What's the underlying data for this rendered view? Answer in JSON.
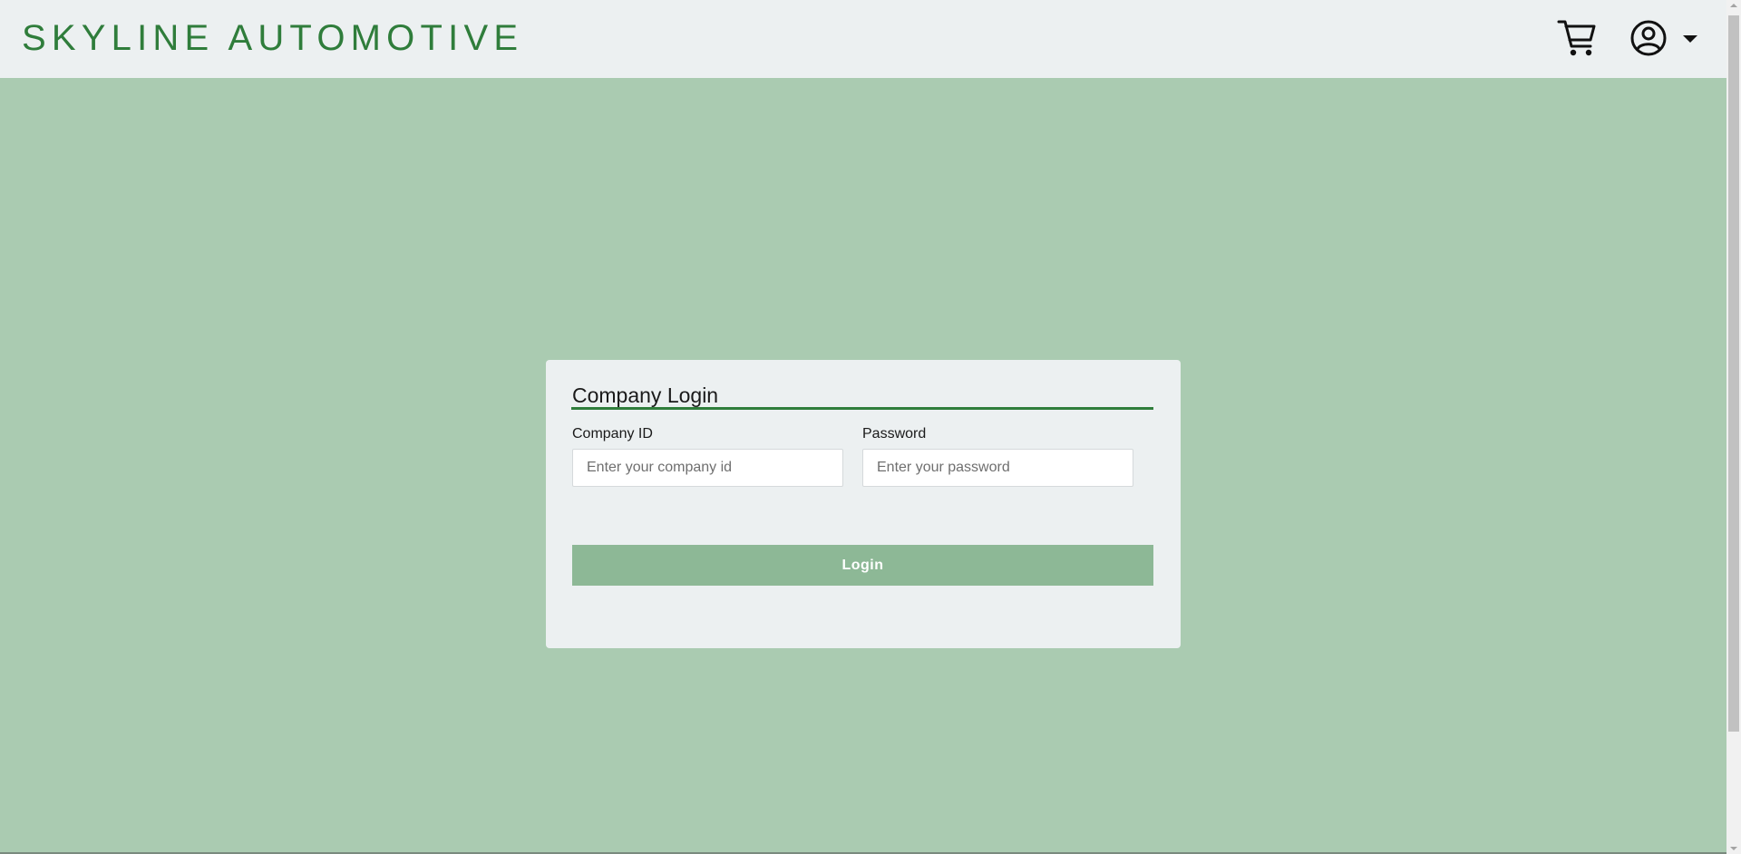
{
  "header": {
    "brand": "SKYLINE AUTOMOTIVE",
    "cart_icon": "cart-icon",
    "account_icon": "user-circle-icon",
    "account_menu_icon": "caret-down-icon"
  },
  "login_card": {
    "title": "Company Login",
    "company_id": {
      "label": "Company ID",
      "placeholder": "Enter your company id",
      "value": ""
    },
    "password": {
      "label": "Password",
      "placeholder": "Enter your password",
      "value": ""
    },
    "submit_label": "Login"
  },
  "colors": {
    "brand": "#2f7d3b",
    "page_background": "#aacbb1",
    "header_background": "#ecf0f1",
    "card_background": "#ecf0f1",
    "button_background": "#8db896",
    "button_text": "#ffffff"
  }
}
